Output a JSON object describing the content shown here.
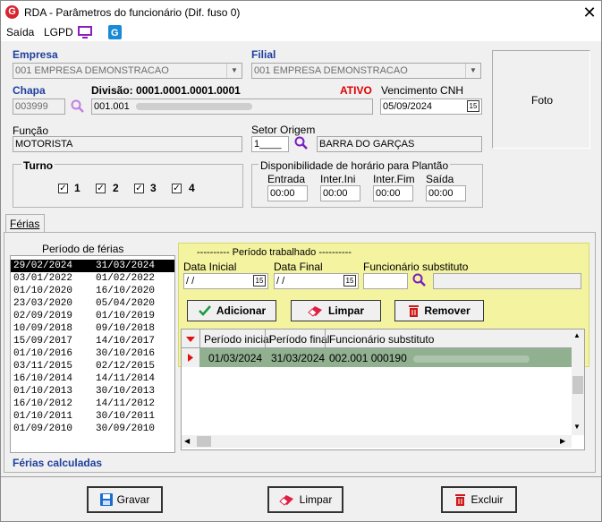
{
  "window": {
    "title": "RDA - Parâmetros do funcionário (Dif. fuso 0)",
    "logo_letter": "G"
  },
  "menu": {
    "saida": "Saída",
    "lgpd": "LGPD"
  },
  "empresa": {
    "label": "Empresa",
    "value": "001 EMPRESA DEMONSTRACAO"
  },
  "filial": {
    "label": "Filial",
    "value": "001 EMPRESA DEMONSTRACAO"
  },
  "chapa": {
    "label": "Chapa",
    "value": "003999"
  },
  "divisao": {
    "label": "Divisão: 0001.0001.0001.0001",
    "value": "001.001"
  },
  "status": "ATIVO",
  "vencimento": {
    "label": "Vencimento  CNH",
    "value": "05/09/2024"
  },
  "foto": {
    "label": "Foto"
  },
  "funcao": {
    "label": "Função",
    "value": "MOTORISTA"
  },
  "setor": {
    "label": "Setor Origem",
    "code": "1____",
    "name": "BARRA DO GARÇAS"
  },
  "turno": {
    "label": "Turno",
    "items": [
      "1",
      "2",
      "3",
      "4"
    ]
  },
  "disponibilidade": {
    "label": "Disponibilidade de horário para Plantão",
    "entrada_label": "Entrada",
    "inter_ini_label": "Inter.Ini",
    "inter_fim_label": "Inter.Fim",
    "saida_label": "Saída",
    "entrada": "00:00",
    "inter_ini": "00:00",
    "inter_fim": "00:00",
    "saida": "00:00"
  },
  "tabs": {
    "ferias": "Férias"
  },
  "periodo_ferias": {
    "header": "Período de férias",
    "rows": [
      {
        "start": "29/02/2024",
        "end": "31/03/2024"
      },
      {
        "start": "03/01/2022",
        "end": "01/02/2022"
      },
      {
        "start": "01/10/2020",
        "end": "16/10/2020"
      },
      {
        "start": "23/03/2020",
        "end": "05/04/2020"
      },
      {
        "start": "02/09/2019",
        "end": "01/10/2019"
      },
      {
        "start": "10/09/2018",
        "end": "09/10/2018"
      },
      {
        "start": "15/09/2017",
        "end": "14/10/2017"
      },
      {
        "start": "01/10/2016",
        "end": "30/10/2016"
      },
      {
        "start": "03/11/2015",
        "end": "02/12/2015"
      },
      {
        "start": "16/10/2014",
        "end": "14/11/2014"
      },
      {
        "start": "01/10/2013",
        "end": "30/10/2013"
      },
      {
        "start": "16/10/2012",
        "end": "14/11/2012"
      },
      {
        "start": "01/10/2011",
        "end": "30/10/2011"
      },
      {
        "start": "01/09/2010",
        "end": "30/09/2010"
      }
    ]
  },
  "ferias_calculadas": "Férias calculadas",
  "periodo_trabalhado": {
    "title": "---------- Período trabalhado ----------",
    "data_inicial_label": "Data Inicial",
    "data_final_label": "Data Final",
    "substituto_label": "Funcionário substituto",
    "data_inicial": " / /",
    "data_final": " / /",
    "adicionar": "Adicionar",
    "limpar": "Limpar",
    "remover": "Remover"
  },
  "grid": {
    "columns": [
      "Período inicial",
      "Período final",
      "Funcionário substituto"
    ],
    "rows": [
      {
        "inicial": "01/03/2024",
        "final": "31/03/2024",
        "substituto": "002.001 000190"
      }
    ]
  },
  "footer": {
    "gravar": "Gravar",
    "limpar": "Limpar",
    "excluir": "Excluir"
  },
  "colors": {
    "accent_blue": "#1f3f9e",
    "status_red": "#e00000",
    "panel_yellow": "#f3f3a0",
    "grid_row_green": "#90b090"
  }
}
